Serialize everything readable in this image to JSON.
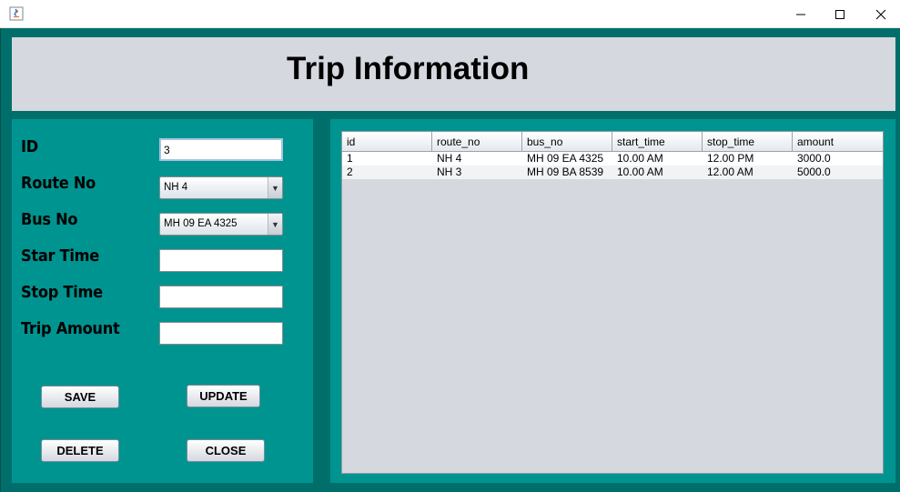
{
  "window": {
    "title": "",
    "controls": {
      "minimize_icon": "minimize-icon",
      "maximize_icon": "maximize-icon",
      "close_icon": "close-icon"
    }
  },
  "header": {
    "title": "Trip Information"
  },
  "form": {
    "labels": {
      "id": "ID",
      "route_no": "Route No",
      "bus_no": "Bus No",
      "start_time": "Star Time",
      "stop_time": "Stop Time",
      "amount": "Trip Amount"
    },
    "values": {
      "id": "3",
      "route_no": "NH 4",
      "bus_no": "MH 09 EA 4325",
      "start_time": "",
      "stop_time": "",
      "amount": ""
    },
    "buttons": {
      "save": "SAVE",
      "update": "UPDATE",
      "delete": "DELETE",
      "close": "CLOSE"
    }
  },
  "table": {
    "columns": [
      "id",
      "route_no",
      "bus_no",
      "start_time",
      "stop_time",
      "amount"
    ],
    "rows": [
      [
        "1",
        "NH 4",
        "MH 09 EA 4325",
        "10.00 AM",
        "12.00 PM",
        "3000.0"
      ],
      [
        "2",
        "NH 3",
        "MH 09 BA 8539",
        "10.00 AM",
        "12.00 AM",
        "5000.0"
      ]
    ]
  },
  "colors": {
    "frame": "#006f6c",
    "panel": "#009491",
    "header_panel": "#d5d8de",
    "table_background": "#d5d8de"
  }
}
